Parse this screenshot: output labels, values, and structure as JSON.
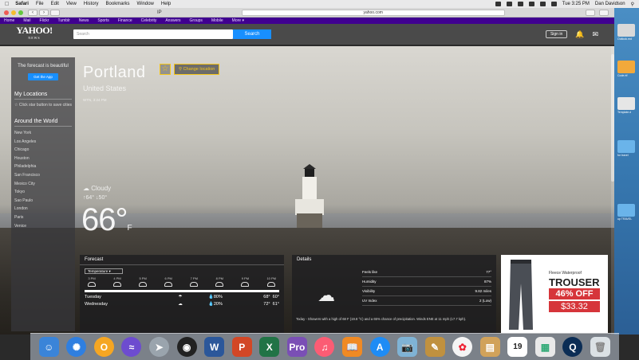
{
  "menubar": {
    "app": "Safari",
    "items": [
      "File",
      "Edit",
      "View",
      "History",
      "Bookmarks",
      "Window",
      "Help"
    ],
    "clock": "Tue 3:25 PM",
    "user": "Dan Davidson"
  },
  "browser": {
    "tab_title": "IP",
    "url": "yahoo.com",
    "nav_back": "‹",
    "nav_fwd": "›"
  },
  "yahoo_nav": [
    "Home",
    "Mail",
    "Flickr",
    "Tumblr",
    "News",
    "Sports",
    "Finance",
    "Celebrity",
    "Answers",
    "Groups",
    "Mobile",
    "More ▾"
  ],
  "header": {
    "logo": "YAHOO!",
    "logo_sub": "NEWS",
    "search_placeholder": "Search",
    "search_button": "Search",
    "sign_in": "Sign in"
  },
  "sidebar": {
    "tagline": "The forecast is beautiful",
    "get_app": "Get the App",
    "my_locations": "My Locations",
    "locations_note": "Click star button to save cities",
    "around_world": "Around the World",
    "cities": [
      "New York",
      "Los Angeles",
      "Chicago",
      "Houston",
      "Philadelphia",
      "San Francisco",
      "Mexico City",
      "Tokyo",
      "Sao Paulo",
      "London",
      "Paris",
      "Venice"
    ]
  },
  "location": {
    "city": "Portland",
    "country": "United States",
    "change": "Change location",
    "date": "WTN, 3:24 PM"
  },
  "current": {
    "condition": "Cloudy",
    "hi": "64°",
    "lo": "50°",
    "temp": "66°",
    "unit": "F"
  },
  "forecast": {
    "title": "Forecast",
    "selector": "Temperature ▾",
    "hours": [
      "3 PM",
      "4 PM",
      "5 PM",
      "6 PM",
      "7 PM",
      "8 PM",
      "9 PM",
      "10 PM"
    ],
    "days": [
      {
        "name": "Tuesday",
        "precip": "80%",
        "hi": "68°",
        "lo": "60°"
      },
      {
        "name": "Wednesday",
        "precip": "20%",
        "hi": "72°",
        "lo": "61°"
      }
    ]
  },
  "details": {
    "title": "Details",
    "rows": [
      {
        "label": "Feels like",
        "value": "77°"
      },
      {
        "label": "Humidity",
        "value": "87%"
      },
      {
        "label": "Visibility",
        "value": "9.82 miles"
      },
      {
        "label": "UV Index",
        "value": "2 (Low)"
      }
    ],
    "summary": "Today - Showers with a high of 68 F (19.8 °C) and a 65% chance of precipitation. Winds ENE at 11 mph (17.7 kph)."
  },
  "ad": {
    "brand": "Fleece Waterproof",
    "product": "TROUSER",
    "discount": "46% OFF",
    "price": "$33.32"
  },
  "desktop_icons": [
    "Outlook.md",
    "Code.rtf",
    "Template.d",
    "for travel",
    "up TRAVEL"
  ]
}
